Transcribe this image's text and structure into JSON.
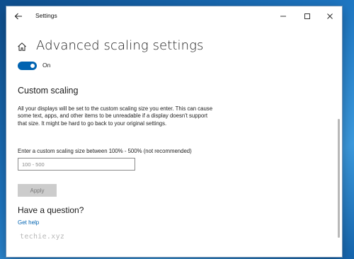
{
  "window": {
    "title": "Settings",
    "controls": {
      "minimize": "minimize",
      "maximize": "maximize",
      "close": "close"
    }
  },
  "page": {
    "title": "Advanced scaling settings",
    "toggle": {
      "state_label": "On",
      "on": true
    }
  },
  "custom_scaling": {
    "heading": "Custom scaling",
    "description": "All your displays will be set to the custom scaling size you enter. This can cause some text, apps, and other items to be unreadable if a display doesn't support that size. It might be hard to go back to your original settings.",
    "field_label": "Enter a custom scaling size between 100% - 500% (not recommended)",
    "input_placeholder": "100 - 500",
    "input_value": "",
    "apply_label": "Apply"
  },
  "help": {
    "heading": "Have a question?",
    "link_label": "Get help"
  },
  "watermark": "techie.xyz",
  "icons": {
    "back": "back-arrow-icon",
    "home": "home-icon",
    "minimize": "minimize-icon",
    "maximize": "maximize-icon",
    "close": "close-icon"
  },
  "colors": {
    "accent": "#0063b1",
    "apply_disabled": "#cccccc",
    "link": "#0063b1"
  }
}
